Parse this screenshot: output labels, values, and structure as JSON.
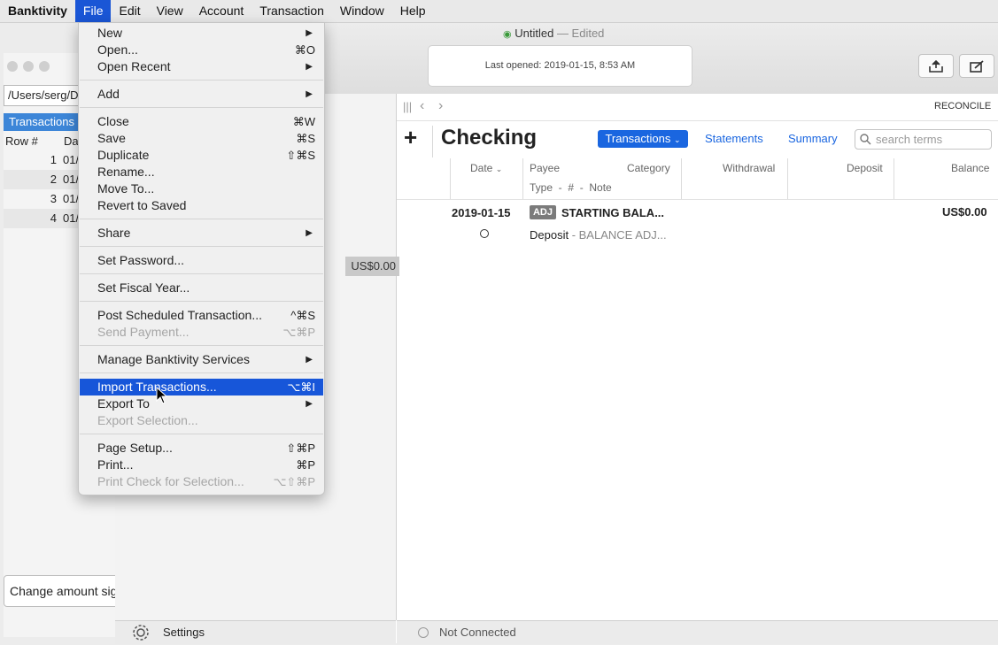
{
  "menubar": {
    "app": "Banktivity",
    "items": [
      "File",
      "Edit",
      "View",
      "Account",
      "Transaction",
      "Window",
      "Help"
    ]
  },
  "file_menu": {
    "groups": [
      [
        {
          "label": "New",
          "arrow": true
        },
        {
          "label": "Open...",
          "shortcut": "⌘O"
        },
        {
          "label": "Open Recent",
          "arrow": true
        }
      ],
      [
        {
          "label": "Add",
          "arrow": true
        }
      ],
      [
        {
          "label": "Close",
          "shortcut": "⌘W"
        },
        {
          "label": "Save",
          "shortcut": "⌘S"
        },
        {
          "label": "Duplicate",
          "shortcut": "⇧⌘S"
        },
        {
          "label": "Rename..."
        },
        {
          "label": "Move To..."
        },
        {
          "label": "Revert to Saved"
        }
      ],
      [
        {
          "label": "Share",
          "arrow": true
        }
      ],
      [
        {
          "label": "Set Password..."
        }
      ],
      [
        {
          "label": "Set Fiscal Year..."
        }
      ],
      [
        {
          "label": "Post Scheduled Transaction...",
          "shortcut": "^⌘S"
        },
        {
          "label": "Send Payment...",
          "shortcut": "⌥⌘P",
          "disabled": true
        }
      ],
      [
        {
          "label": "Manage Banktivity Services",
          "arrow": true
        }
      ],
      [
        {
          "label": "Import Transactions...",
          "shortcut": "⌥⌘I",
          "highlighted": true
        },
        {
          "label": "Export To",
          "arrow": true
        },
        {
          "label": "Export Selection...",
          "disabled": true
        }
      ],
      [
        {
          "label": "Page Setup...",
          "shortcut": "⇧⌘P"
        },
        {
          "label": "Print...",
          "shortcut": "⌘P"
        },
        {
          "label": "Print Check for Selection...",
          "shortcut": "⌥⇧⌘P",
          "disabled": true
        }
      ]
    ]
  },
  "window": {
    "title": "Untitled",
    "edited": "— Edited",
    "last_opened": "Last opened: 2019-01-15, 8:53 AM"
  },
  "back_window": {
    "path": "/Users/serg/D",
    "tab": "Transactions",
    "col_row": "Row #",
    "col_date": "Da",
    "rows": [
      {
        "n": "1",
        "d": "01/"
      },
      {
        "n": "2",
        "d": "01/"
      },
      {
        "n": "3",
        "d": "01/"
      },
      {
        "n": "4",
        "d": "01/"
      }
    ],
    "button": "Change amount sig"
  },
  "sidebar": {
    "balance": "US$0.00",
    "settings": "Settings"
  },
  "content": {
    "reconcile": "RECONCILE",
    "account": "Checking",
    "tabs": {
      "transactions": "Transactions",
      "statements": "Statements",
      "summary": "Summary"
    },
    "search_placeholder": "search terms",
    "columns": {
      "date": "Date",
      "payee": "Payee",
      "category": "Category",
      "withdrawal": "Withdrawal",
      "deposit": "Deposit",
      "balance": "Balance",
      "subline": "Type  -  #  -  Note"
    },
    "transaction": {
      "date": "2019-01-15",
      "type_badge": "ADJ",
      "payee": "STARTING BALA...",
      "balance": "US$0.00",
      "sub_type": "Deposit",
      "sub_note": " - BALANCE ADJ..."
    },
    "status": "Not Connected"
  },
  "colors": {
    "accent": "#1a66e0",
    "menu_highlight": "#1756d9"
  }
}
